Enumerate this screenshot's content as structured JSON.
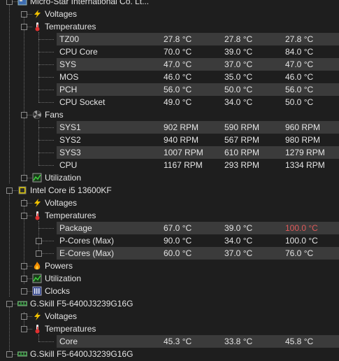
{
  "rows": [
    {
      "label": "Micro-Star International Co. Lt...",
      "icon": "motherboard-icon"
    },
    {
      "label": "Voltages",
      "icon": "voltage-bolt-icon"
    },
    {
      "label": "Temperatures",
      "icon": "thermometer-icon"
    },
    {
      "label": "TZ00",
      "v": [
        "27.8 °C",
        "27.8 °C",
        "27.8 °C"
      ]
    },
    {
      "label": "CPU Core",
      "v": [
        "70.0 °C",
        "39.0 °C",
        "84.0 °C"
      ]
    },
    {
      "label": "SYS",
      "v": [
        "47.0 °C",
        "37.0 °C",
        "47.0 °C"
      ]
    },
    {
      "label": "MOS",
      "v": [
        "46.0 °C",
        "35.0 °C",
        "46.0 °C"
      ]
    },
    {
      "label": "PCH",
      "v": [
        "56.0 °C",
        "50.0 °C",
        "56.0 °C"
      ]
    },
    {
      "label": "CPU Socket",
      "v": [
        "49.0 °C",
        "34.0 °C",
        "50.0 °C"
      ]
    },
    {
      "label": "Fans",
      "icon": "fan-icon"
    },
    {
      "label": "SYS1",
      "v": [
        "902 RPM",
        "590 RPM",
        "960 RPM"
      ]
    },
    {
      "label": "SYS2",
      "v": [
        "940 RPM",
        "567 RPM",
        "980 RPM"
      ]
    },
    {
      "label": "SYS3",
      "v": [
        "1007 RPM",
        "610 RPM",
        "1279 RPM"
      ]
    },
    {
      "label": "CPU",
      "v": [
        "1167 RPM",
        "293 RPM",
        "1334 RPM"
      ]
    },
    {
      "label": "Utilization",
      "icon": "utilization-chart-icon"
    },
    {
      "label": "Intel Core i5 13600KF",
      "icon": "cpu-chip-icon"
    },
    {
      "label": "Voltages",
      "icon": "voltage-bolt-icon"
    },
    {
      "label": "Temperatures",
      "icon": "thermometer-icon"
    },
    {
      "label": "Package",
      "v": [
        "67.0 °C",
        "39.0 °C",
        "100.0 °C"
      ],
      "max_alert": true
    },
    {
      "label": "P-Cores (Max)",
      "v": [
        "90.0 °C",
        "34.0 °C",
        "100.0 °C"
      ]
    },
    {
      "label": "E-Cores (Max)",
      "v": [
        "60.0 °C",
        "37.0 °C",
        "76.0 °C"
      ]
    },
    {
      "label": "Powers",
      "icon": "flame-icon"
    },
    {
      "label": "Utilization",
      "icon": "utilization-chart-icon"
    },
    {
      "label": "Clocks",
      "icon": "clock-bars-icon"
    },
    {
      "label": "G.Skill F5-6400J3239G16G",
      "icon": "memory-module-icon"
    },
    {
      "label": "Voltages",
      "icon": "voltage-bolt-icon"
    },
    {
      "label": "Temperatures",
      "icon": "thermometer-icon"
    },
    {
      "label": "Core",
      "v": [
        "45.3 °C",
        "33.8 °C",
        "45.8 °C"
      ]
    },
    {
      "label": "G.Skill F5-6400J3239G16G",
      "icon": "memory-module-icon"
    }
  ],
  "colors": {
    "alert": "#e05a5a",
    "highlight": "#3b3b3b"
  }
}
